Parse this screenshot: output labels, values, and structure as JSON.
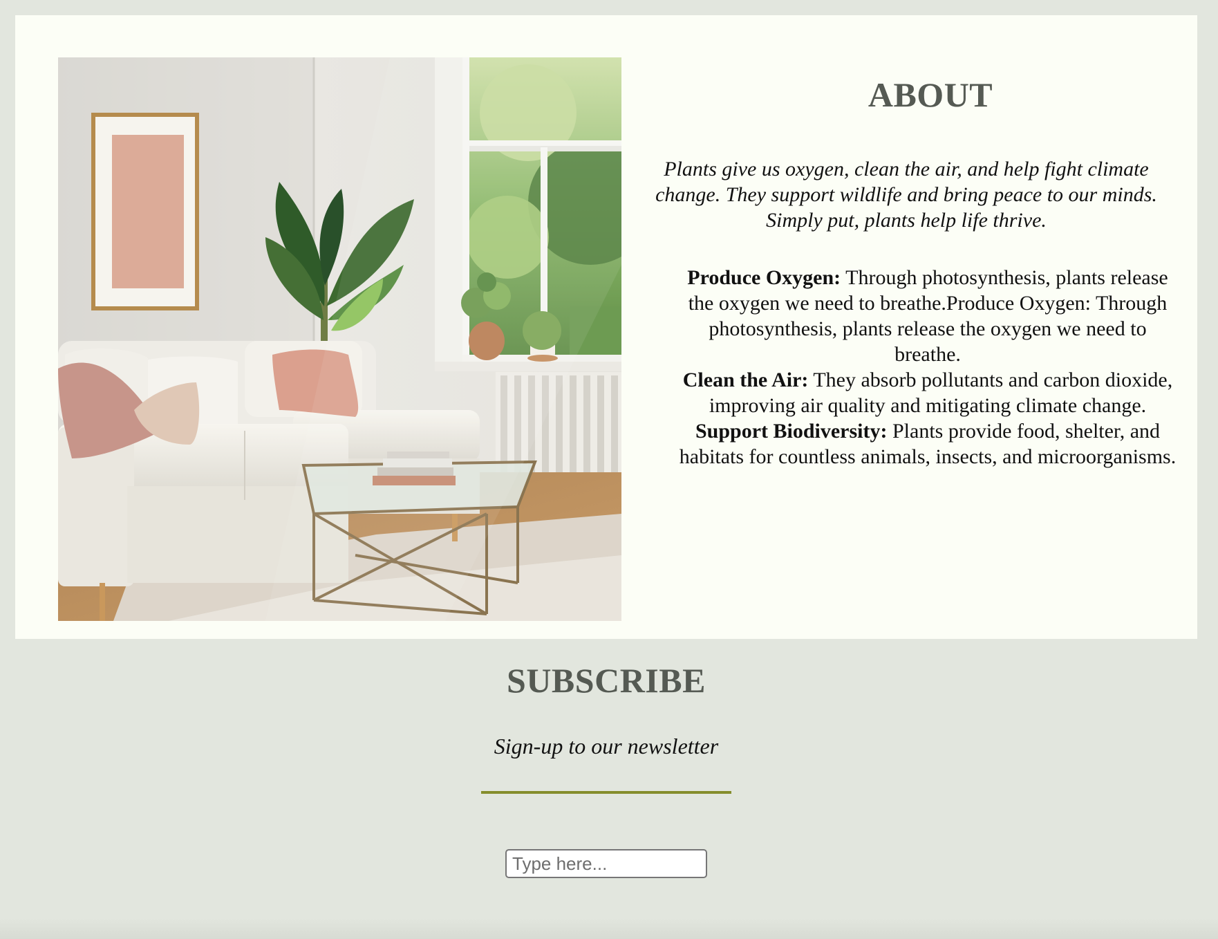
{
  "about": {
    "image_alt": "Bright living room with white sectional sofa, pink cushions, leafy plant, glass coffee table and window",
    "title": "ABOUT",
    "intro": "Plants give us oxygen, clean the air, and help fight climate change. They support wildlife and bring peace to our minds. Simply put, plants help life thrive.",
    "benefits": [
      {
        "heading": "Produce Oxygen:",
        "text": " Through photosynthesis, plants release the oxygen we need to breathe.Produce Oxygen: Through photosynthesis, plants release the oxygen we need to breathe."
      },
      {
        "heading": "Clean the Air:",
        "text": " They absorb pollutants and carbon dioxide, improving air quality and mitigating climate change."
      },
      {
        "heading": "Support Biodiversity:",
        "text": " Plants provide food, shelter, and habitats for countless animals, insects, and microorganisms."
      }
    ]
  },
  "subscribe": {
    "title": "SUBSCRIBE",
    "subtitle": "Sign-up to our newsletter",
    "input_placeholder": "Type here..."
  },
  "colors": {
    "page_background": "#e2e6de",
    "card_background": "#fcfef6",
    "heading": "#555a53",
    "divider": "#858d2c"
  }
}
